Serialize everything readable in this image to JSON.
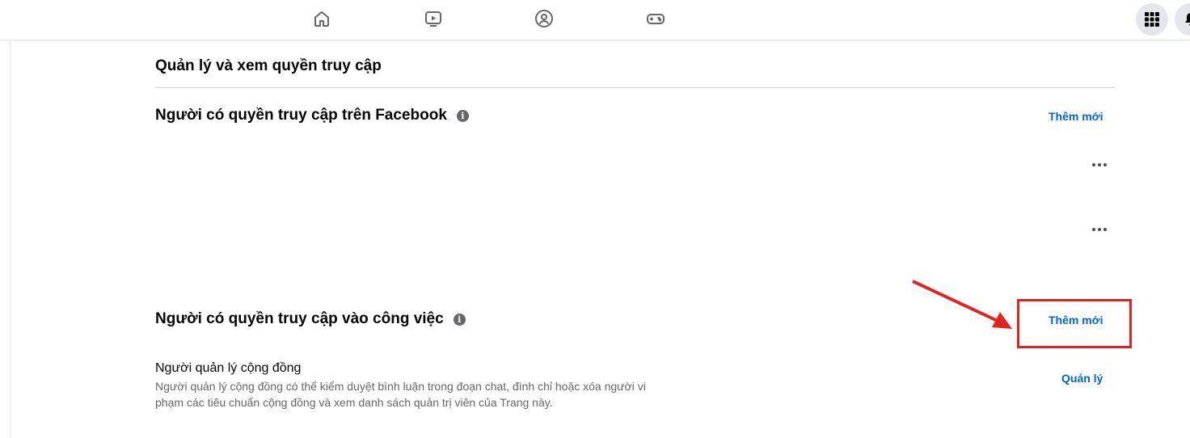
{
  "topbar": {
    "nav_icons": [
      "home-icon",
      "video-icon",
      "groups-icon",
      "gaming-icon"
    ],
    "right_icons": [
      "menu-grid-icon",
      "notifications-icon"
    ]
  },
  "page": {
    "section_title": "Quản lý và xem quyền truy cập",
    "facebook_access": {
      "heading": "Người có quyền truy cập trên Facebook",
      "add_label": "Thêm mới",
      "more_label": "•••"
    },
    "task_access": {
      "heading": "Người có quyền truy cập vào công việc",
      "add_label": "Thêm mới"
    },
    "community_manager": {
      "title": "Người quản lý cộng đồng",
      "description": "Người quản lý cộng đồng có thể kiểm duyệt bình luận trong đoạn chat, đình chỉ hoặc xóa người vi phạm các tiêu chuẩn cộng đồng và xem danh sách quản trị viên của Trang này.",
      "manage_label": "Quản lý"
    },
    "info_glyph": "i"
  },
  "annotation": {
    "color": "#e02424"
  }
}
